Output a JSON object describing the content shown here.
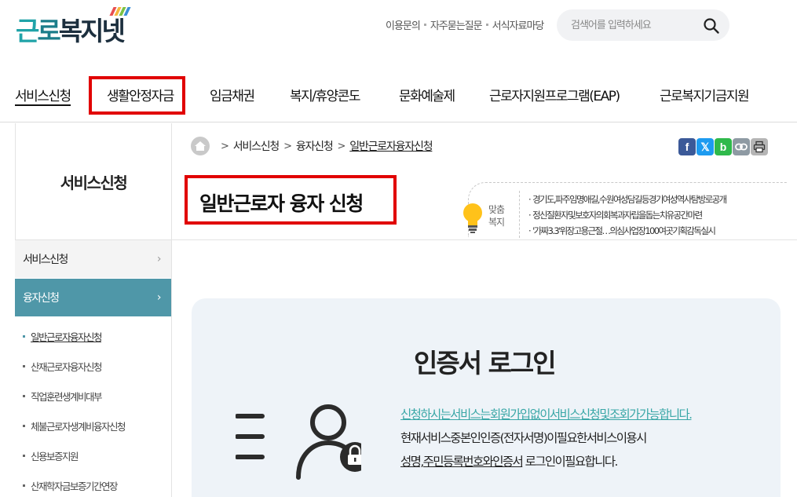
{
  "header": {
    "logo_text": "근로복지넷",
    "logo_colors": [
      "#20a3a8",
      "#1b7d8a",
      "#1c2f3e"
    ],
    "logo_stripes": [
      "#e84f4f",
      "#f6b73c",
      "#7cc243",
      "#3b8fd8"
    ],
    "util_links": [
      "이용문의",
      "자주묻는질문",
      "서식자료마당"
    ],
    "search": {
      "placeholder": "검색어를 입력하세요",
      "icon": "search-icon"
    }
  },
  "gnb": {
    "items": [
      "서비스신청",
      "생활안정자금",
      "임금채권",
      "복지/휴양콘도",
      "문화예술제",
      "근로자지원프로그램(EAP)",
      "근로복지기금지원"
    ],
    "active_index": 0,
    "highlighted_index": 1
  },
  "lnb": {
    "title": "서비스신청",
    "depth1": [
      {
        "label": "서비스신청",
        "chevron": "›"
      },
      {
        "label": "융자신청",
        "chevron": "›"
      }
    ],
    "sub_items": [
      "일반근로자융자신청",
      "산재근로자융자신청",
      "직업훈련생계비대부",
      "체불근로자생계비융자신청",
      "신용보증지원",
      "산재학자금보증기간연장"
    ],
    "current_sub_index": 0
  },
  "breadcrumb": {
    "home_icon": "home-icon",
    "items": [
      "서비스신청",
      "융자신청",
      "일반근로자융자신청"
    ]
  },
  "share": {
    "buttons": [
      {
        "name": "facebook",
        "glyph": "f",
        "color": "#3b5998"
      },
      {
        "name": "x",
        "glyph": "𝕏",
        "color": "#1d9bf0"
      },
      {
        "name": "band",
        "glyph": "b",
        "color": "#2fb94b"
      },
      {
        "name": "link",
        "glyph": "",
        "color": "#8e9aa3"
      },
      {
        "name": "print",
        "glyph": "",
        "color": "#b5b5b5"
      }
    ]
  },
  "page": {
    "title": "일반근로자 융자 신청"
  },
  "ticker": {
    "tag": [
      "맞춤",
      "복지"
    ],
    "items": [
      "경기도,파주임명애길,수원여성담길등경기여성역사탐방로공개",
      "정신질환자및보호자의회복과자립을돕는치유공간마련",
      "'가짜3.3'위장고용근절…의심사업장100여곳기획감독실시"
    ]
  },
  "login_panel": {
    "title": "인증서 로그인",
    "line1": "신청하시는서비스는회원가입없이서비스신청및조회가가능합니다.",
    "line2": "현재서비스중본인인증(전자서명)이필요한서비스이용시",
    "line3_ul": "성명,주민등록번호와인증서",
    "line3_rest": " 로그인이필요합니다."
  }
}
